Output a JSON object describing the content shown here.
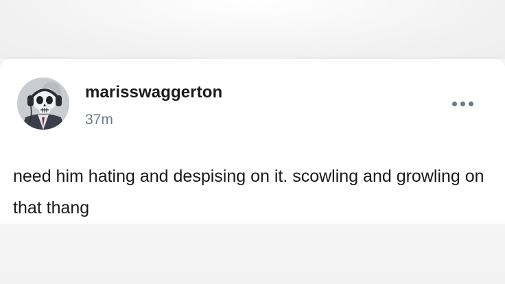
{
  "post": {
    "username": "marisswaggerton",
    "timestamp": "37m",
    "body": "need him hating and despising on it. scowling and growling on that thang",
    "more_icon": "ellipsis-icon",
    "avatar_icon": "skull-headphones-avatar"
  },
  "colors": {
    "text_primary": "#1a1a1a",
    "text_secondary": "#6b7a87",
    "card_background": "#ffffff",
    "page_background": "#f4f4f4"
  }
}
